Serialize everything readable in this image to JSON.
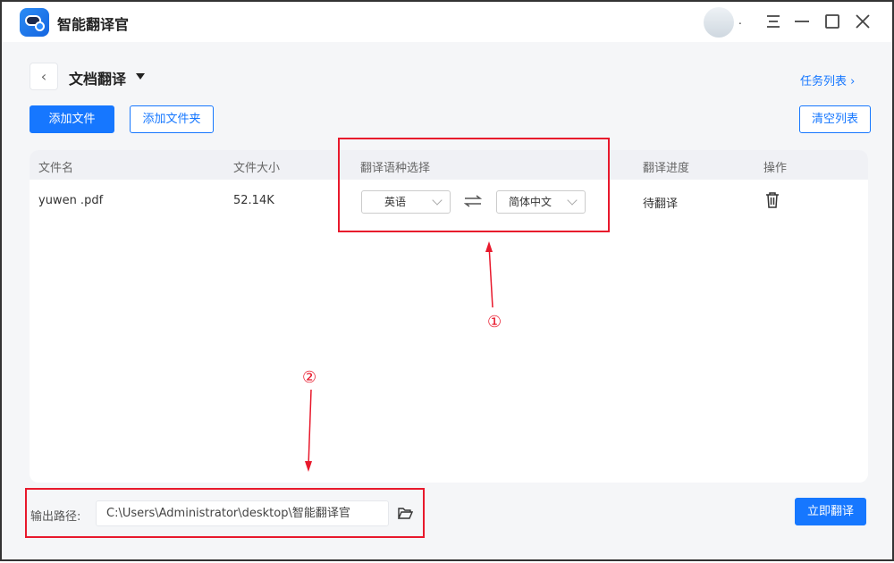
{
  "app": {
    "title": "智能翻译官",
    "user_suffix": "."
  },
  "header": {
    "title": "文档翻译",
    "task_list": "任务列表 ›"
  },
  "toolbar": {
    "add_file": "添加文件",
    "add_folder": "添加文件夹",
    "clear_list": "清空列表"
  },
  "table": {
    "columns": [
      "文件名",
      "文件大小",
      "翻译语种选择",
      "翻译进度",
      "操作"
    ],
    "rows": [
      {
        "name": "yuwen .pdf",
        "size": "52.14K",
        "source_lang": "英语",
        "target_lang": "简体中文",
        "status": "待翻译"
      }
    ]
  },
  "footer": {
    "output_label": "输出路径:",
    "output_path": "C:\\Users\\Administrator\\desktop\\智能翻译官",
    "translate_now": "立即翻译"
  },
  "annotations": {
    "one": "①",
    "two": "②",
    "color": "#e8192c"
  },
  "colors": {
    "accent": "#1677ff"
  }
}
